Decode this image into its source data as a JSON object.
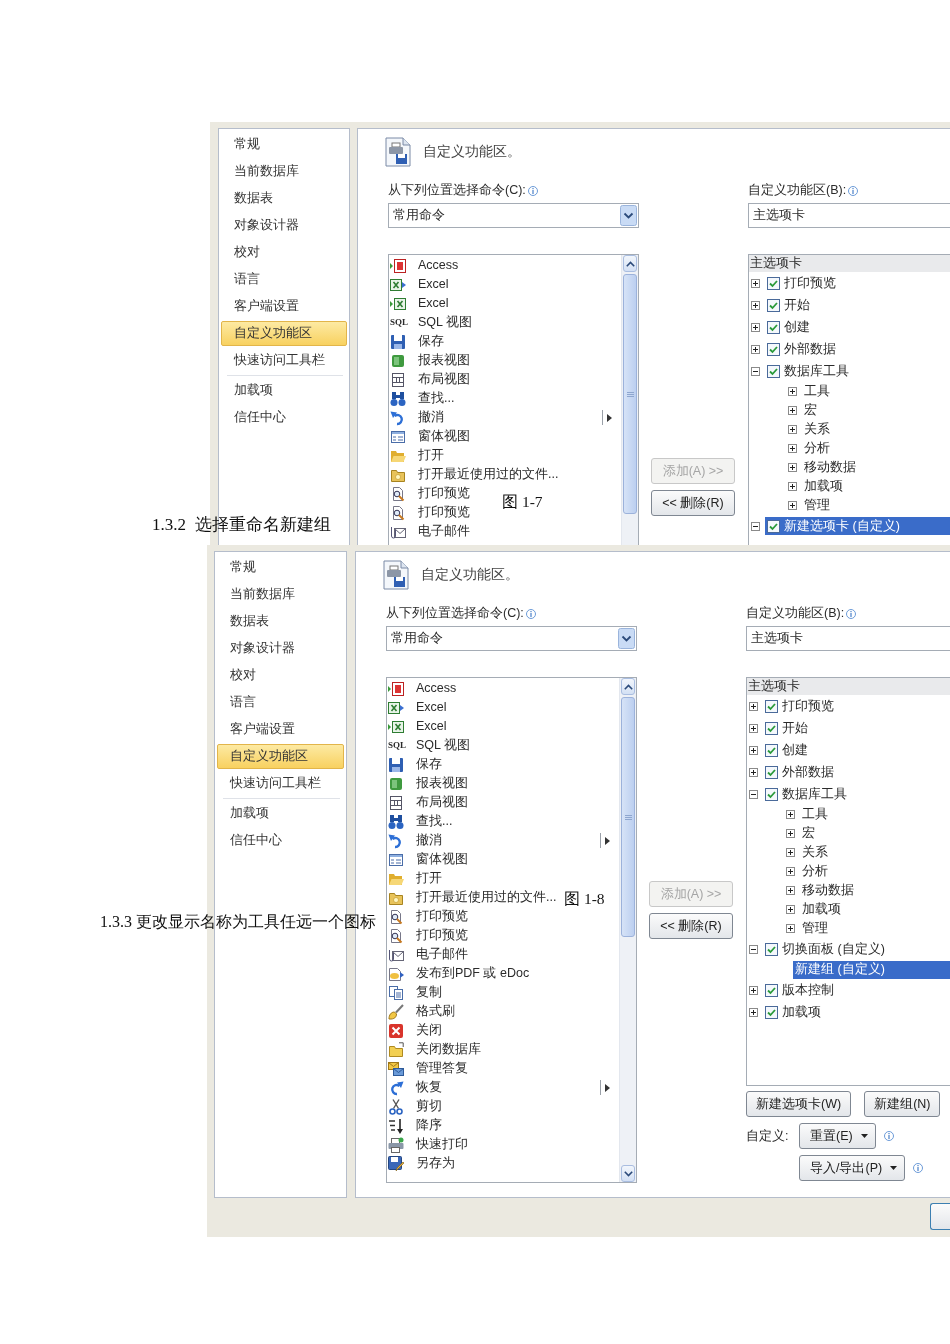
{
  "figures": [
    {
      "dialog": {
        "sidebar": {
          "sections": [
            {
              "items": [
                {
                  "label": "常规",
                  "selected": false
                },
                {
                  "label": "当前数据库",
                  "selected": false
                },
                {
                  "label": "数据表",
                  "selected": false
                },
                {
                  "label": "对象设计器",
                  "selected": false
                },
                {
                  "label": "校对",
                  "selected": false
                },
                {
                  "label": "语言",
                  "selected": false
                },
                {
                  "label": "客户端设置",
                  "selected": false
                },
                {
                  "label": "自定义功能区",
                  "selected": true
                },
                {
                  "label": "快速访问工具栏",
                  "selected": false
                }
              ]
            },
            {
              "items": [
                {
                  "label": "加载项",
                  "selected": false
                },
                {
                  "label": "信任中心",
                  "selected": false
                }
              ]
            }
          ]
        },
        "header": {
          "title": "自定义功能区。"
        },
        "commands": {
          "label": "从下列位置选择命令(C):",
          "dropdown": "常用命令",
          "items": [
            {
              "label": "Access",
              "submenu": false
            },
            {
              "label": "Excel",
              "submenu": false
            },
            {
              "label": "Excel",
              "submenu": false
            },
            {
              "label": "SQL 视图",
              "icon_text": "SQL",
              "submenu": false
            },
            {
              "label": "保存",
              "submenu": false
            },
            {
              "label": "报表视图",
              "submenu": false
            },
            {
              "label": "布局视图",
              "submenu": false
            },
            {
              "label": "查找...",
              "submenu": false
            },
            {
              "label": "撤消",
              "submenu": true
            },
            {
              "label": "窗体视图",
              "submenu": false
            },
            {
              "label": "打开",
              "submenu": false
            },
            {
              "label": "打开最近使用过的文件...",
              "submenu": false
            },
            {
              "label": "打印预览",
              "submenu": false
            },
            {
              "label": "打印预览",
              "submenu": false
            },
            {
              "label": "电子邮件",
              "submenu": false
            }
          ]
        },
        "transfer_buttons": [
          {
            "label": "添加(A) >>",
            "disabled": true
          },
          {
            "label": "<< 删除(R)",
            "disabled": false
          }
        ],
        "ribbon": {
          "label": "自定义功能区(B):",
          "dropdown": "主选项卡",
          "tree": {
            "header": "主选项卡",
            "items": [
              {
                "label": "打印预览",
                "checked": true,
                "expanded": false,
                "selected": false
              },
              {
                "label": "开始",
                "checked": true,
                "expanded": false,
                "selected": false
              },
              {
                "label": "创建",
                "checked": true,
                "expanded": false,
                "selected": false
              },
              {
                "label": "外部数据",
                "checked": true,
                "expanded": false,
                "selected": false
              },
              {
                "label": "数据库工具",
                "checked": true,
                "expanded": true,
                "selected": false,
                "children": [
                  {
                    "label": "工具",
                    "expanded": false,
                    "selected": false
                  },
                  {
                    "label": "宏",
                    "expanded": false,
                    "selected": false
                  },
                  {
                    "label": "关系",
                    "expanded": false,
                    "selected": false
                  },
                  {
                    "label": "分析",
                    "expanded": false,
                    "selected": false
                  },
                  {
                    "label": "移动数据",
                    "expanded": false,
                    "selected": false
                  },
                  {
                    "label": "加载项",
                    "expanded": false,
                    "selected": false
                  },
                  {
                    "label": "管理",
                    "expanded": false,
                    "selected": false
                  }
                ]
              },
              {
                "label": "新建选项卡 (自定义)",
                "checked": true,
                "expanded": true,
                "selected": true
              }
            ]
          }
        }
      },
      "caption": "图 1-7",
      "heading": "1.3.2  选择重命名新建组"
    },
    {
      "dialog": {
        "sidebar": {
          "sections": [
            {
              "items": [
                {
                  "label": "常规",
                  "selected": false
                },
                {
                  "label": "当前数据库",
                  "selected": false
                },
                {
                  "label": "数据表",
                  "selected": false
                },
                {
                  "label": "对象设计器",
                  "selected": false
                },
                {
                  "label": "校对",
                  "selected": false
                },
                {
                  "label": "语言",
                  "selected": false
                },
                {
                  "label": "客户端设置",
                  "selected": false
                },
                {
                  "label": "自定义功能区",
                  "selected": true
                },
                {
                  "label": "快速访问工具栏",
                  "selected": false
                }
              ]
            },
            {
              "items": [
                {
                  "label": "加载项",
                  "selected": false
                },
                {
                  "label": "信任中心",
                  "selected": false
                }
              ]
            }
          ]
        },
        "header": {
          "title": "自定义功能区。"
        },
        "commands": {
          "label": "从下列位置选择命令(C):",
          "dropdown": "常用命令",
          "items": [
            {
              "label": "Access",
              "submenu": false
            },
            {
              "label": "Excel",
              "submenu": false
            },
            {
              "label": "Excel",
              "submenu": false
            },
            {
              "label": "SQL 视图",
              "icon_text": "SQL",
              "submenu": false
            },
            {
              "label": "保存",
              "submenu": false
            },
            {
              "label": "报表视图",
              "submenu": false
            },
            {
              "label": "布局视图",
              "submenu": false
            },
            {
              "label": "查找...",
              "submenu": false
            },
            {
              "label": "撤消",
              "submenu": true
            },
            {
              "label": "窗体视图",
              "submenu": false
            },
            {
              "label": "打开",
              "submenu": false
            },
            {
              "label": "打开最近使用过的文件...",
              "submenu": false
            },
            {
              "label": "打印预览",
              "submenu": false
            },
            {
              "label": "打印预览",
              "submenu": false
            },
            {
              "label": "电子邮件",
              "submenu": false
            },
            {
              "label": "发布到PDF 或 eDoc",
              "submenu": false
            },
            {
              "label": "复制",
              "submenu": false
            },
            {
              "label": "格式刷",
              "submenu": false
            },
            {
              "label": "关闭",
              "submenu": false
            },
            {
              "label": "关闭数据库",
              "submenu": false
            },
            {
              "label": "管理答复",
              "submenu": false
            },
            {
              "label": "恢复",
              "submenu": true
            },
            {
              "label": "剪切",
              "submenu": false
            },
            {
              "label": "降序",
              "submenu": false
            },
            {
              "label": "快速打印",
              "submenu": false
            },
            {
              "label": "另存为",
              "submenu": false
            }
          ]
        },
        "transfer_buttons": [
          {
            "label": "添加(A) >>",
            "disabled": true
          },
          {
            "label": "<< 删除(R)",
            "disabled": false
          }
        ],
        "ribbon": {
          "label": "自定义功能区(B):",
          "dropdown": "主选项卡",
          "tree": {
            "header": "主选项卡",
            "items": [
              {
                "label": "打印预览",
                "checked": true,
                "expanded": false,
                "selected": false
              },
              {
                "label": "开始",
                "checked": true,
                "expanded": false,
                "selected": false
              },
              {
                "label": "创建",
                "checked": true,
                "expanded": false,
                "selected": false
              },
              {
                "label": "外部数据",
                "checked": true,
                "expanded": false,
                "selected": false
              },
              {
                "label": "数据库工具",
                "checked": true,
                "expanded": true,
                "selected": false,
                "children": [
                  {
                    "label": "工具",
                    "expanded": false,
                    "selected": false
                  },
                  {
                    "label": "宏",
                    "expanded": false,
                    "selected": false
                  },
                  {
                    "label": "关系",
                    "expanded": false,
                    "selected": false
                  },
                  {
                    "label": "分析",
                    "expanded": false,
                    "selected": false
                  },
                  {
                    "label": "移动数据",
                    "expanded": false,
                    "selected": false
                  },
                  {
                    "label": "加载项",
                    "expanded": false,
                    "selected": false
                  },
                  {
                    "label": "管理",
                    "expanded": false,
                    "selected": false
                  }
                ]
              },
              {
                "label": "切换面板 (自定义)",
                "checked": true,
                "expanded": true,
                "selected": false,
                "children": [
                  {
                    "label": "新建组 (自定义)",
                    "selected": true
                  }
                ]
              },
              {
                "label": "版本控制",
                "checked": true,
                "expanded": false,
                "selected": false
              },
              {
                "label": "加载项",
                "checked": true,
                "expanded": false,
                "selected": false
              }
            ]
          },
          "buttons": [
            "新建选项卡(W)",
            "新建组(N)"
          ],
          "customize": {
            "label": "自定义:",
            "reset": "重置(E)",
            "import_export": "导入/导出(P)"
          }
        }
      },
      "caption": "图 1-8",
      "heading": "1.3.3 更改显示名称为工具任远一个图标"
    }
  ]
}
